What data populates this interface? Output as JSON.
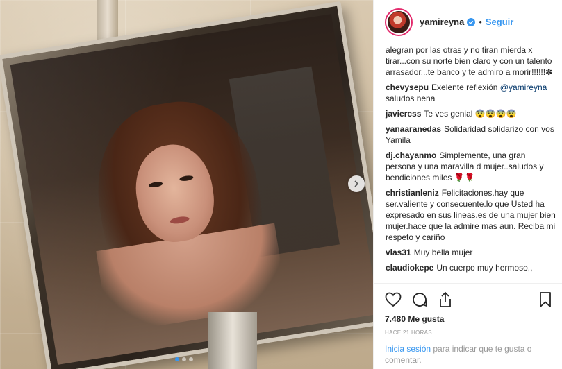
{
  "post": {
    "carousel": {
      "total": 3,
      "active_index": 1
    }
  },
  "header": {
    "username": "yamireyna",
    "separator": "•",
    "follow_label": "Seguir"
  },
  "comments": {
    "clipped_caption": "alegran por las otras y no tiran mierda x tirar...con su norte bien claro y con un talento arrasador...te banco y te admiro a morir!!!!!!✽",
    "items": [
      {
        "user": "chevysepu",
        "text": "Exelente reflexión ",
        "mention": "@yamireyna",
        "text_after": " saludos nena"
      },
      {
        "user": "javiercss",
        "text": "Te ves genial 😨😨😨😨"
      },
      {
        "user": "yanaaranedas",
        "text": "Solidaridad solidarizo con vos Yamila"
      },
      {
        "user": "dj.chayanmo",
        "text": "Simplemente, una gran persona y una maravilla d mujer..saludos y bendiciones miles 🌹🌹"
      },
      {
        "user": "christianleniz",
        "text": "Felicitaciones.hay que ser.valiente y consecuente.lo que Usted ha expresado en sus lineas.es de una mujer bien mujer.hace que la admire mas aun. Reciba mi respeto y cariño"
      },
      {
        "user": "vlas31",
        "text": "Muy bella mujer"
      },
      {
        "user": "claudiokepe",
        "text": "Un cuerpo muy hermoso,,"
      }
    ]
  },
  "actions": {
    "likes": "7.480 Me gusta",
    "time": "HACE 21 HORAS",
    "icons": [
      "heart-icon",
      "comment-icon",
      "share-icon",
      "bookmark-icon"
    ]
  },
  "login": {
    "link": "Inicia sesión",
    "rest": " para indicar que te gusta o comentar."
  },
  "colors": {
    "link": "#3897f0",
    "verified": "#3897f0",
    "text": "#262626",
    "muted": "#999999"
  }
}
